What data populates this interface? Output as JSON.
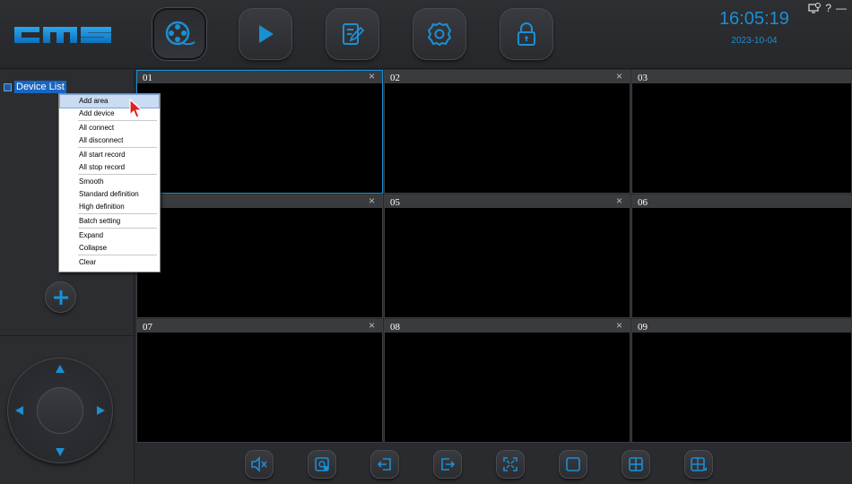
{
  "app": {
    "logo_text": "CMS"
  },
  "toolbar": {
    "buttons": [
      {
        "name": "live-view",
        "icon": "film-reel-icon",
        "active": true
      },
      {
        "name": "playback",
        "icon": "play-icon",
        "active": false
      },
      {
        "name": "log",
        "icon": "edit-note-icon",
        "active": false
      },
      {
        "name": "settings",
        "icon": "gear-icon",
        "active": false
      },
      {
        "name": "lock",
        "icon": "lock-icon",
        "active": false
      }
    ]
  },
  "clock": {
    "time": "16:05:19",
    "date": "2023-10-04"
  },
  "window_controls": {
    "help": "?",
    "minimize": "—"
  },
  "sidebar": {
    "root_label": "Device List"
  },
  "context_menu": {
    "groups": [
      [
        "Add area",
        "Add device"
      ],
      [
        "All connect",
        "All disconnect"
      ],
      [
        "All start record",
        "All stop record"
      ],
      [
        "Smooth",
        "Standard definition",
        "High definition"
      ],
      [
        "Batch setting"
      ],
      [
        "Expand",
        "Collapse"
      ],
      [
        "Clear"
      ]
    ],
    "hovered": "Add area"
  },
  "grid": {
    "cells": [
      {
        "num": "01",
        "close": "×",
        "selected": true
      },
      {
        "num": "02",
        "close": "×"
      },
      {
        "num": "03",
        "close": ""
      },
      {
        "num": "",
        "close": "×"
      },
      {
        "num": "05",
        "close": "×"
      },
      {
        "num": "06",
        "close": ""
      },
      {
        "num": "07",
        "close": "×"
      },
      {
        "num": "08",
        "close": "×"
      },
      {
        "num": "09",
        "close": ""
      }
    ]
  },
  "bottom_toolbar": {
    "buttons": [
      "mute-icon",
      "snapshot-icon",
      "previous-page-icon",
      "next-page-icon",
      "fullscreen-icon",
      "single-view-icon",
      "quad-view-icon",
      "custom-layout-icon"
    ]
  },
  "colors": {
    "accent": "#1b8fd4",
    "selection": "#1766c4",
    "background": "#2a2b2e"
  }
}
